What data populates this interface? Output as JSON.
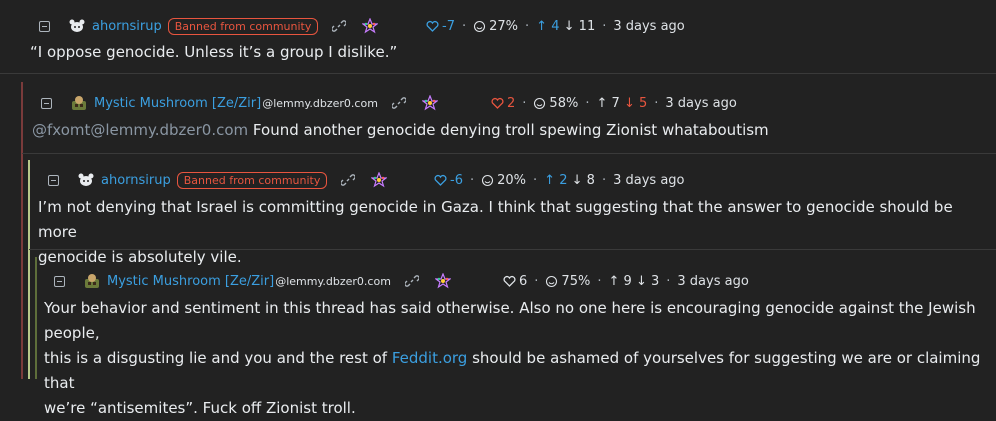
{
  "comments": [
    {
      "user": "ahornsirup",
      "instance": "",
      "badge": "Banned from community",
      "score": "-7",
      "percent": "27%",
      "up": "4",
      "down": "11",
      "time": "3 days ago",
      "body": "“I oppose genocide. Unless it’s a group I dislike.”",
      "score_color": "#3b9fe0"
    },
    {
      "user": "Mystic Mushroom [Ze/Zir]",
      "instance": "@lemmy.dbzer0.com",
      "score": "2",
      "percent": "58%",
      "up": "7",
      "down": "5",
      "time": "3 days ago",
      "mention": "@fxomt@lemmy.dbzer0.com",
      "body": " Found another genocide denying troll spewing Zionist whataboutism",
      "score_color": "#e8553f"
    },
    {
      "user": "ahornsirup",
      "instance": "",
      "badge": "Banned from community",
      "score": "-6",
      "percent": "20%",
      "up": "2",
      "down": "8",
      "time": "3 days ago",
      "body_line1": "I’m not denying that Israel is committing genocide in Gaza. I think that suggesting that the answer to genocide should be more",
      "body_line2": "genocide is absolutely vile.",
      "score_color": "#3b9fe0"
    },
    {
      "user": "Mystic Mushroom [Ze/Zir]",
      "instance": "@lemmy.dbzer0.com",
      "score": "6",
      "percent": "75%",
      "up": "9",
      "down": "3",
      "time": "3 days ago",
      "body_line1": "Your behavior and sentiment in this thread has said otherwise. Also no one here is encouraging genocide against the Jewish people,",
      "body_line2a": "this is a disgusting lie and you and the rest of ",
      "body_link": "Feddit.org",
      "body_line2b": " should be ashamed of yourselves for suggesting we are or claiming that",
      "body_line3": "we’re “antisemites”. Fuck off Zionist troll.",
      "score_color": "#dee2e6"
    }
  ],
  "colors": {
    "thread_line_1": "#7a3b3b",
    "thread_line_2": "#b8c98a",
    "thread_line_3": "#5e6e3a"
  },
  "icons": [
    "collapse-icon",
    "avatar-icon",
    "link-icon",
    "fediverse-icon",
    "heart-icon",
    "smiley-icon",
    "arrow-up-icon",
    "arrow-down-icon"
  ]
}
